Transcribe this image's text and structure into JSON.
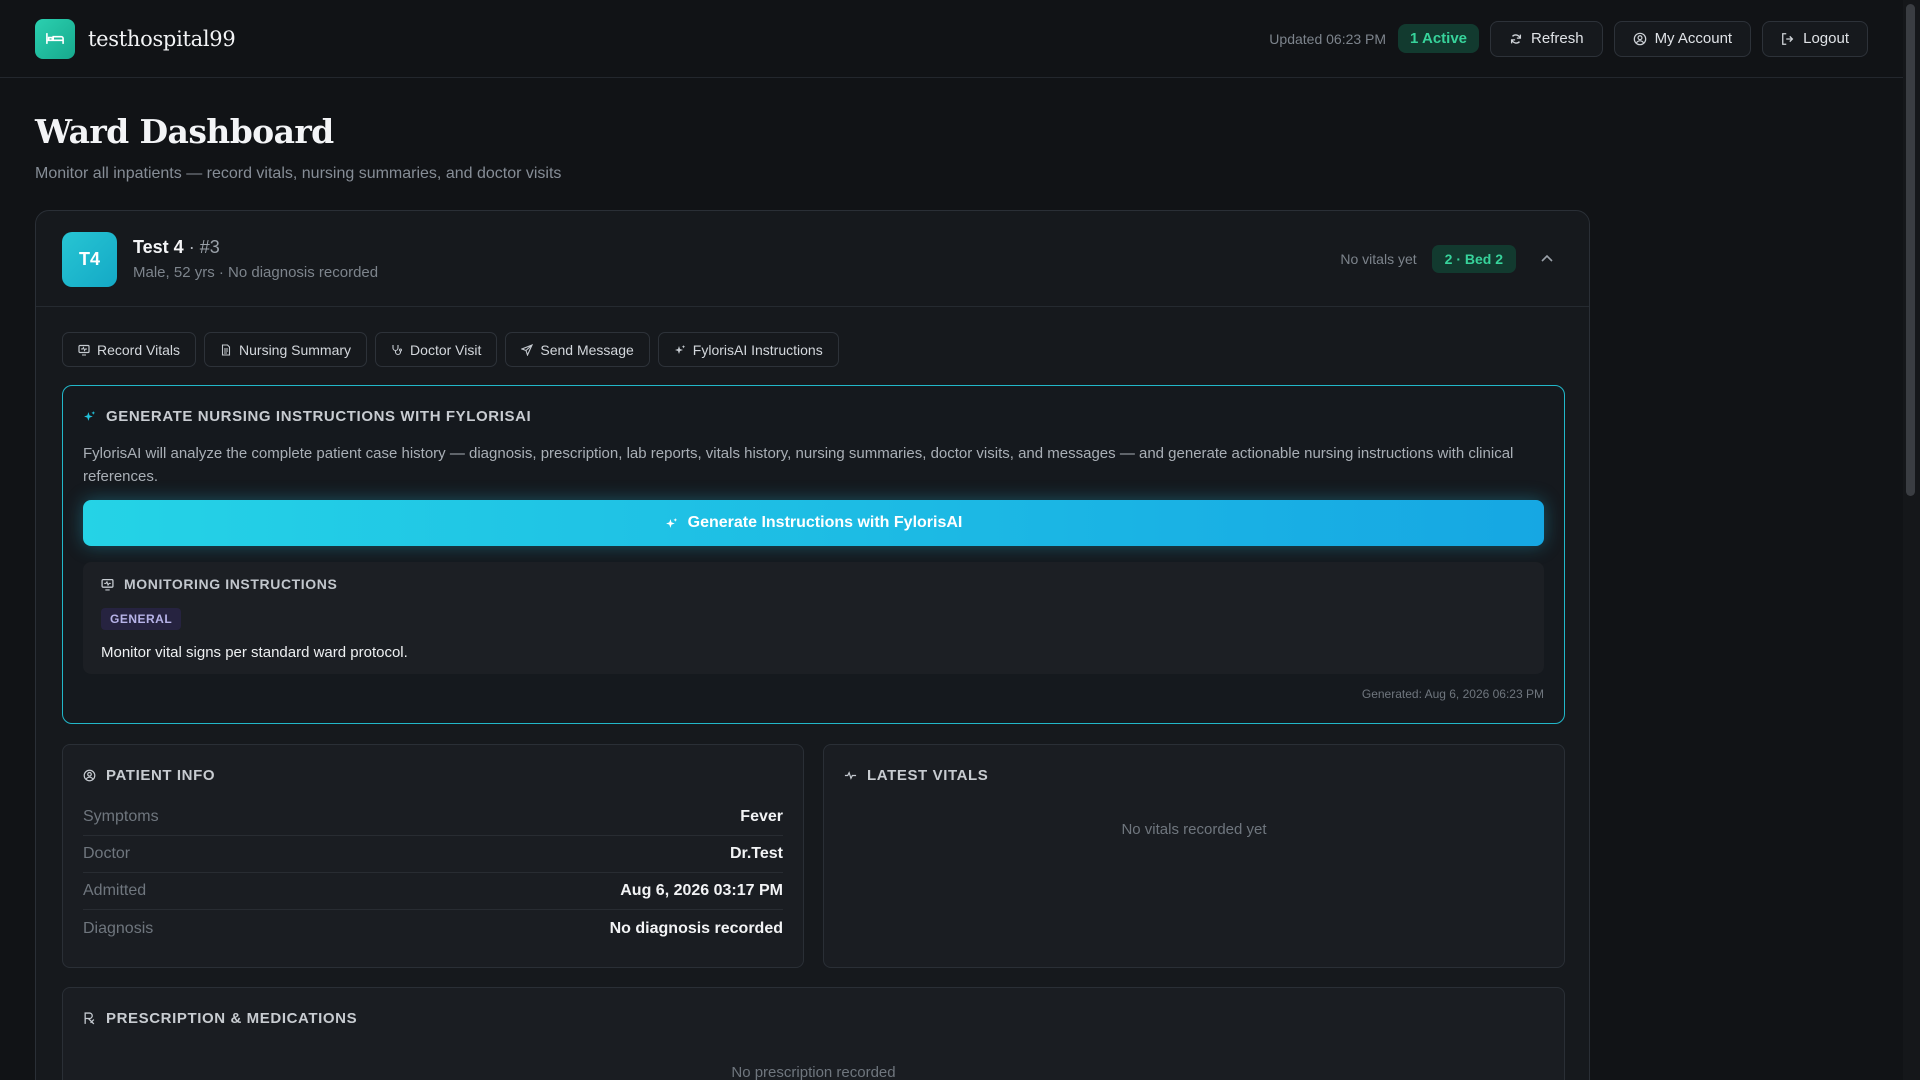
{
  "header": {
    "brand": "testhospital99",
    "updated": "Updated 06:23 PM",
    "active_badge": "1 Active",
    "refresh_label": "Refresh",
    "account_label": "My Account",
    "logout_label": "Logout"
  },
  "page": {
    "title": "Ward Dashboard",
    "subtitle": "Monitor all inpatients — record vitals, nursing summaries, and doctor visits"
  },
  "patient": {
    "initials": "T4",
    "name": "Test 4",
    "separator": "·",
    "id": "#3",
    "meta": "Male, 52 yrs · No diagnosis recorded",
    "vitals_status": "No vitals yet",
    "bed": "2 · Bed 2"
  },
  "actions": [
    {
      "label": "Record Vitals",
      "icon": "monitor-icon"
    },
    {
      "label": "Nursing Summary",
      "icon": "document-icon"
    },
    {
      "label": "Doctor Visit",
      "icon": "stethoscope-icon"
    },
    {
      "label": "Send Message",
      "icon": "send-icon"
    },
    {
      "label": "FylorisAI Instructions",
      "icon": "sparkle-icon"
    }
  ],
  "ai_panel": {
    "title": "Generate Nursing Instructions with FylorisAI",
    "description": "FylorisAI will analyze the complete patient case history — diagnosis, prescription, lab reports, vitals history, nursing summaries, doctor visits, and messages — and generate actionable nursing instructions with clinical references.",
    "button_label": "Generate Instructions with FylorisAI",
    "monitoring": {
      "title": "Monitoring Instructions",
      "tag": "GENERAL",
      "text": "Monitor vital signs per standard ward protocol."
    },
    "generated": "Generated: Aug 6, 2026 06:23 PM"
  },
  "patient_info": {
    "title": "Patient Info",
    "rows": [
      {
        "key": "Symptoms",
        "value": "Fever"
      },
      {
        "key": "Doctor",
        "value": "Dr.Test"
      },
      {
        "key": "Admitted",
        "value": "Aug 6, 2026 03:17 PM"
      },
      {
        "key": "Diagnosis",
        "value": "No diagnosis recorded"
      }
    ]
  },
  "latest_vitals": {
    "title": "Latest Vitals",
    "empty": "No vitals recorded yet"
  },
  "prescription": {
    "title": "Prescription & Medications",
    "empty": "No prescription recorded"
  },
  "colors": {
    "accent": "#22c3dc",
    "success": "#37d39b",
    "background": "#111316"
  }
}
